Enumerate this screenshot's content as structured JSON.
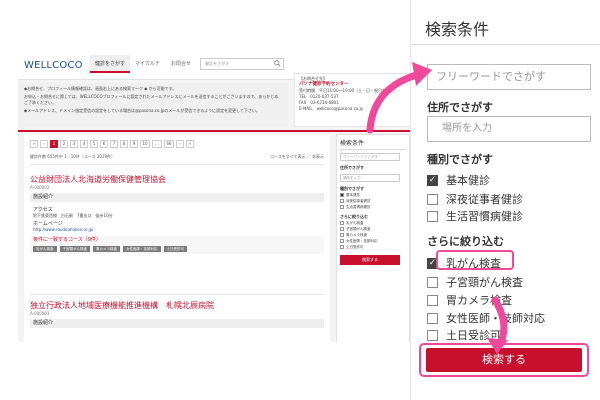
{
  "site": {
    "logo": "WELLCOCO",
    "nav": [
      "健診をさがす",
      "マイカルテ",
      "お問合せ"
    ],
    "search_placeholder": "健診をさがす",
    "notice": [
      "◆お問合せ、プロフィール情報確認は、画面右上にある検索マーク ◆ から可能です。",
      "お申込・お問合せに際しては、WELLCOCOプロフィールに設定されたメールアドレスにメールを送信することがございますので、あらかじめご了承ください。",
      "◆メールアドレス、ドメイン指定受信の設定をしている場合は@pasona.co.jpのメールが受信できるように設定を変更して下さい。"
    ],
    "contact": {
      "title": "【お問合せ先】",
      "name": "パソナ健診予約センター",
      "hours": "受付時間　平日11:00〜19:00（土・日・祝日を除く）",
      "tel": "TEL　0120-037-537",
      "fax": "FAX　03-6734-0801",
      "email": "E-MAIL　wellcoco@pasona.co.jp"
    },
    "pager": [
      "«",
      "‹",
      "1",
      "2",
      "3",
      "4",
      "5",
      "6",
      "7",
      "8",
      "9",
      "10",
      "...",
      "66",
      "›",
      "»"
    ],
    "result_count": "健診件数 655件中 1 - 10件（コース 3029件）",
    "result_links": "コースをすべて表示 ／ 非表示",
    "cards": [
      {
        "title": "公益財団法人北海道労働保健管理協会",
        "id": "A-000002",
        "section": "施設紹介",
        "access_label": "アクセス",
        "access": "地下鉄東西線　白石駅　7番出口　徒歩10分",
        "hp_label": "ホームページ",
        "hp": "http://www.roudouhoken.or.jp/",
        "course": "条件に一致するコース（9件）",
        "tags": [
          "乳がん検査",
          "子宮頸がん検査",
          "胃カメラ検査",
          "女性医師・技師対応",
          "土日受診可"
        ]
      },
      {
        "title": "独立行政法人地域医療機能推進機構　札幌北辰病院",
        "id": "A-000003",
        "section": "施設紹介"
      }
    ],
    "sidebar": {
      "title": "検索条件",
      "free": "フリーワードでさがす",
      "addr_label": "住所でさがす",
      "addr": "場所を入力",
      "kind_label": "種別でさがす",
      "kinds": [
        "基本健診",
        "深夜従事者健診",
        "生活習慣病健診"
      ],
      "more_label": "さらに絞り込む",
      "more": [
        "乳がん検査",
        "子宮頸がん検査",
        "胃カメラ検査",
        "女性医師・技師対応",
        "土日受診可"
      ],
      "button": "検索する"
    }
  },
  "zoom": {
    "title": "検索条件",
    "free_placeholder": "フリーワードでさがす",
    "addr_label": "住所でさがす",
    "addr_placeholder": "場所を入力",
    "kind_label": "種別でさがす",
    "kinds": [
      "基本健診",
      "深夜従事者健診",
      "生活習慣病健診"
    ],
    "kinds_checked": [
      true,
      false,
      false
    ],
    "more_label": "さらに絞り込む",
    "more": [
      "乳がん検査",
      "子宮頸がん検査",
      "胃カメラ検査",
      "女性医師・技師対応",
      "土日受診可"
    ],
    "more_checked": [
      true,
      false,
      false,
      false,
      false
    ],
    "button": "検索する"
  },
  "colors": {
    "accent": "#c8102e",
    "highlight": "#f0489a",
    "logo": "#1b4f91"
  }
}
